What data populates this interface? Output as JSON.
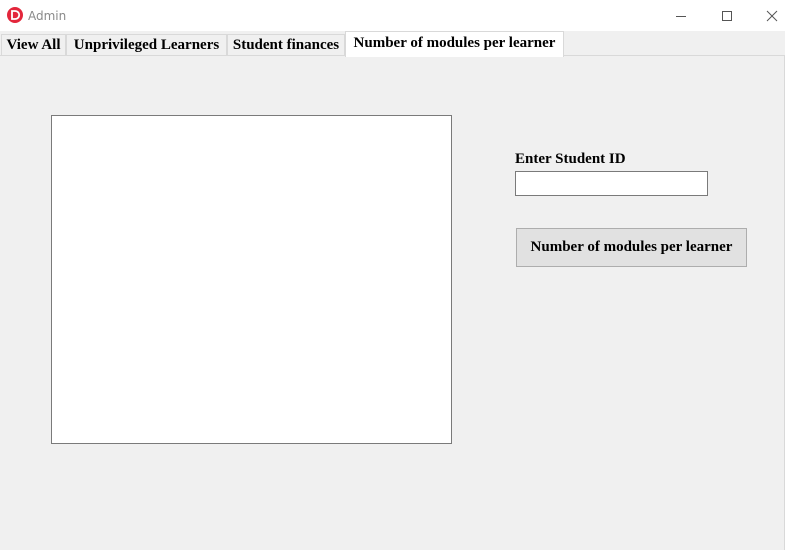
{
  "window": {
    "title": "Admin",
    "app_icon": "d-logo-icon",
    "accent_color": "#e3263b",
    "controls": [
      "minimize-icon",
      "maximize-icon",
      "close-icon"
    ]
  },
  "tabs": [
    {
      "label": "View All",
      "active": false
    },
    {
      "label": "Unprivileged Learners",
      "active": false
    },
    {
      "label": "Student finances",
      "active": false
    },
    {
      "label": "Number of modules per learner",
      "active": true
    }
  ],
  "form": {
    "student_id_label": "Enter Student ID",
    "student_id_value": "",
    "action_button_label": "Number of modules per learner"
  }
}
